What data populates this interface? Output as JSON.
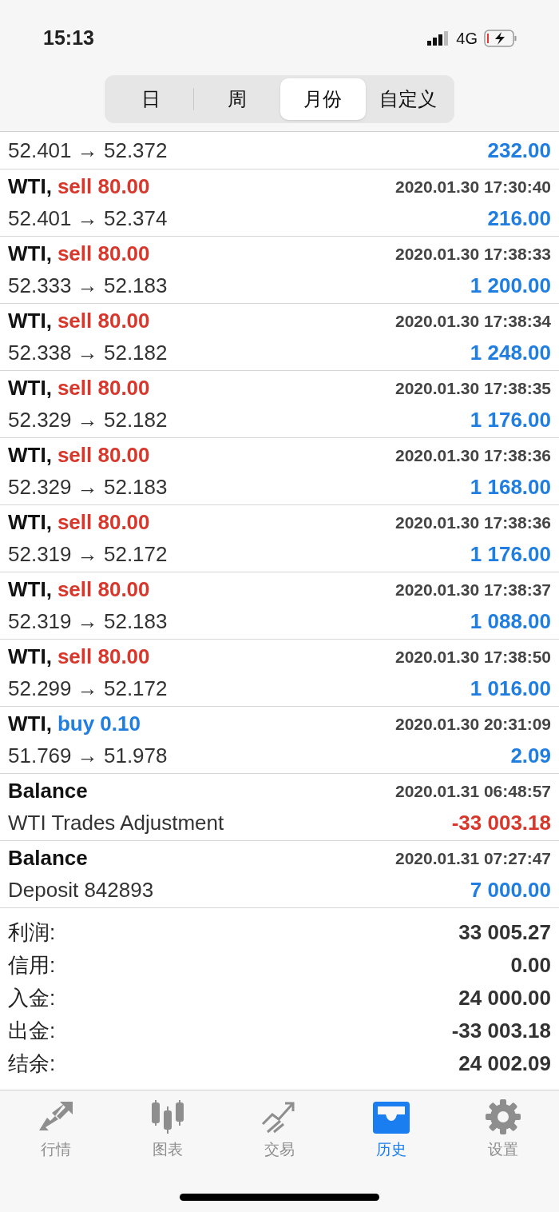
{
  "status_bar": {
    "time": "15:13",
    "network": "4G"
  },
  "period_tabs": [
    {
      "label": "日",
      "selected": false
    },
    {
      "label": "周",
      "selected": false
    },
    {
      "label": "月份",
      "selected": true
    },
    {
      "label": "自定义",
      "selected": false
    }
  ],
  "deals": [
    {
      "prices": "52.401 → 52.372",
      "profit": "232.00",
      "negative": false
    },
    {
      "symbol": "WTI,",
      "action": "sell 80.00",
      "is_buy": false,
      "time": "2020.01.30 17:30:40",
      "prices": "52.401 → 52.374",
      "profit": "216.00",
      "negative": false
    },
    {
      "symbol": "WTI,",
      "action": "sell 80.00",
      "is_buy": false,
      "time": "2020.01.30 17:38:33",
      "prices": "52.333 → 52.183",
      "profit": "1 200.00",
      "negative": false
    },
    {
      "symbol": "WTI,",
      "action": "sell 80.00",
      "is_buy": false,
      "time": "2020.01.30 17:38:34",
      "prices": "52.338 → 52.182",
      "profit": "1 248.00",
      "negative": false
    },
    {
      "symbol": "WTI,",
      "action": "sell 80.00",
      "is_buy": false,
      "time": "2020.01.30 17:38:35",
      "prices": "52.329 → 52.182",
      "profit": "1 176.00",
      "negative": false
    },
    {
      "symbol": "WTI,",
      "action": "sell 80.00",
      "is_buy": false,
      "time": "2020.01.30 17:38:36",
      "prices": "52.329 → 52.183",
      "profit": "1 168.00",
      "negative": false
    },
    {
      "symbol": "WTI,",
      "action": "sell 80.00",
      "is_buy": false,
      "time": "2020.01.30 17:38:36",
      "prices": "52.319 → 52.172",
      "profit": "1 176.00",
      "negative": false
    },
    {
      "symbol": "WTI,",
      "action": "sell 80.00",
      "is_buy": false,
      "time": "2020.01.30 17:38:37",
      "prices": "52.319 → 52.183",
      "profit": "1 088.00",
      "negative": false
    },
    {
      "symbol": "WTI,",
      "action": "sell 80.00",
      "is_buy": false,
      "time": "2020.01.30 17:38:50",
      "prices": "52.299 → 52.172",
      "profit": "1 016.00",
      "negative": false
    },
    {
      "symbol": "WTI,",
      "action": "buy 0.10",
      "is_buy": true,
      "time": "2020.01.30 20:31:09",
      "prices": "51.769 → 51.978",
      "profit": "2.09",
      "negative": false
    },
    {
      "symbol": "Balance",
      "time": "2020.01.31 06:48:57",
      "prices": "WTI Trades Adjustment",
      "profit": "-33 003.18",
      "negative": true
    },
    {
      "symbol": "Balance",
      "time": "2020.01.31 07:27:47",
      "prices": "Deposit 842893",
      "profit": "7 000.00",
      "negative": false
    }
  ],
  "summary": [
    {
      "label": "利润:",
      "value": "33 005.27"
    },
    {
      "label": "信用:",
      "value": "0.00"
    },
    {
      "label": "入金:",
      "value": "24 000.00"
    },
    {
      "label": "出金:",
      "value": "-33 003.18"
    },
    {
      "label": "结余:",
      "value": "24 002.09"
    }
  ],
  "tab_bar": [
    {
      "kind": "quotes",
      "label": "行情",
      "selected": false
    },
    {
      "kind": "chart",
      "label": "图表",
      "selected": false
    },
    {
      "kind": "trade",
      "label": "交易",
      "selected": false
    },
    {
      "kind": "history",
      "label": "历史",
      "selected": true
    },
    {
      "kind": "settings",
      "label": "设置",
      "selected": false
    }
  ]
}
